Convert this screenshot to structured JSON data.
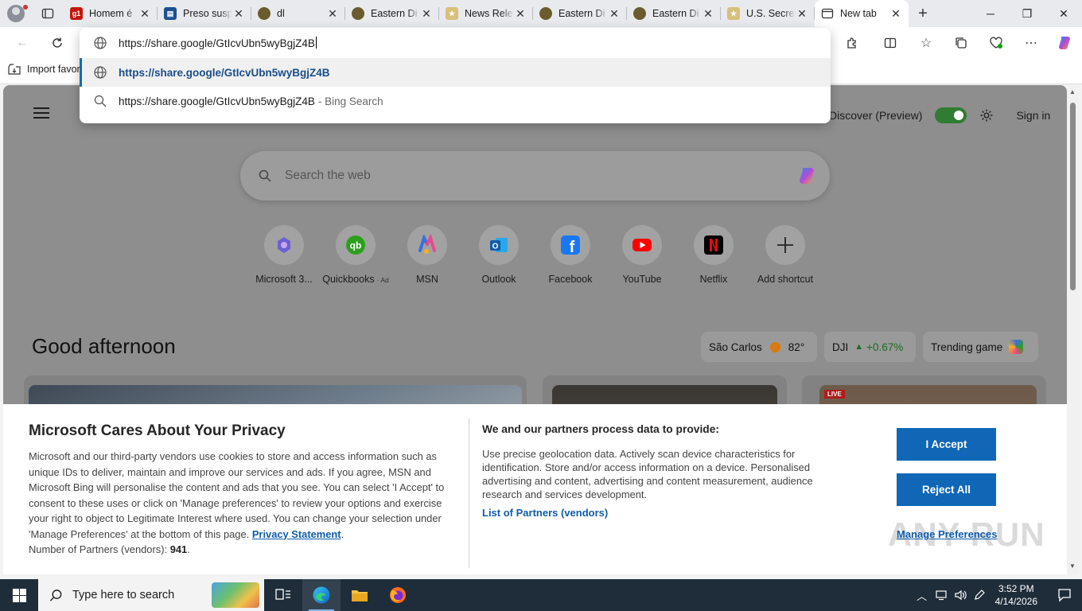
{
  "tabs": [
    {
      "title": "Homem é",
      "favicon": "g1",
      "active": false
    },
    {
      "title": "Preso susp",
      "favicon": "news-icon",
      "active": false
    },
    {
      "title": "dl",
      "favicon": "seal-icon",
      "active": false
    },
    {
      "title": "Eastern Di",
      "favicon": "seal-icon",
      "active": false
    },
    {
      "title": "News Rele",
      "favicon": "star-badge-icon",
      "active": false
    },
    {
      "title": "Eastern Di",
      "favicon": "seal-icon",
      "active": false
    },
    {
      "title": "Eastern Di",
      "favicon": "seal-icon",
      "active": false
    },
    {
      "title": "U.S. Secret",
      "favicon": "star-badge-icon",
      "active": false
    },
    {
      "title": "New tab",
      "favicon": "newtab-icon",
      "active": true
    }
  ],
  "address": {
    "typed": "https://share.google/GtIcvUbn5wyBgjZ4B",
    "suggestions": [
      {
        "text": "https://share.google/GtIcvUbn5wyBgjZ4B",
        "suffix": "",
        "icon": "globe-icon",
        "selected": true
      },
      {
        "text": "https://share.google/GtIcvUbn5wyBgjZ4B",
        "suffix": "- Bing Search",
        "icon": "search-icon",
        "selected": false
      }
    ]
  },
  "favorites_bar": {
    "import_label": "Import favor"
  },
  "newtab": {
    "discover_label": "Discover (Preview)",
    "signin_label": "Sign in",
    "search_placeholder": "Search the web",
    "greeting": "Good afternoon",
    "shortcuts": [
      {
        "label": "Microsoft 3...",
        "ad": "",
        "icon": "microsoft365-icon"
      },
      {
        "label": "Quickbooks",
        "ad": "· Ad",
        "icon": "quickbooks-icon"
      },
      {
        "label": "MSN",
        "ad": "",
        "icon": "msn-icon"
      },
      {
        "label": "Outlook",
        "ad": "",
        "icon": "outlook-icon"
      },
      {
        "label": "Facebook",
        "ad": "",
        "icon": "facebook-icon"
      },
      {
        "label": "YouTube",
        "ad": "",
        "icon": "youtube-icon"
      },
      {
        "label": "Netflix",
        "ad": "",
        "icon": "netflix-icon"
      },
      {
        "label": "Add shortcut",
        "ad": "",
        "icon": "plus-icon"
      }
    ],
    "weather": {
      "city": "São Carlos",
      "temp": "82°"
    },
    "stock": {
      "symbol": "DJI",
      "change": "+0.67%"
    },
    "trending": {
      "label": "Trending game"
    },
    "live_badge": "LIVE"
  },
  "privacy": {
    "title": "Microsoft Cares About Your Privacy",
    "body": "Microsoft and our third-party vendors use cookies to store and access information such as unique IDs to deliver, maintain and improve our services and ads. If you agree, MSN and Microsoft Bing will personalise the content and ads that you see. You can select 'I Accept' to consent to these uses or click on 'Manage preferences' to review your options and exercise your right to object to Legitimate Interest where used.  You can change your selection under 'Manage Preferences' at the bottom of this page.",
    "privacy_link": "Privacy Statement",
    "partners_count_label": "Number of Partners (vendors):",
    "partners_count": "941",
    "heading2": "We and our partners process data to provide:",
    "body2": "Use precise geolocation data. Actively scan device characteristics for identification. Store and/or access information on a device. Personalised advertising and content, advertising and content measurement, audience research and services development.",
    "partners_link": "List of Partners (vendors)",
    "accept": "I Accept",
    "reject": "Reject All",
    "manage": "Manage Preferences"
  },
  "watermark": "ANY RUN",
  "taskbar": {
    "search_placeholder": "Type here to search",
    "time": "3:52 PM",
    "date": "4/14/2026"
  },
  "colors": {
    "accent": "#0f67b6",
    "edge_blue": "#0f6cbd",
    "taskbar": "#1f2d3a",
    "toggle_on": "#2f7d32"
  }
}
